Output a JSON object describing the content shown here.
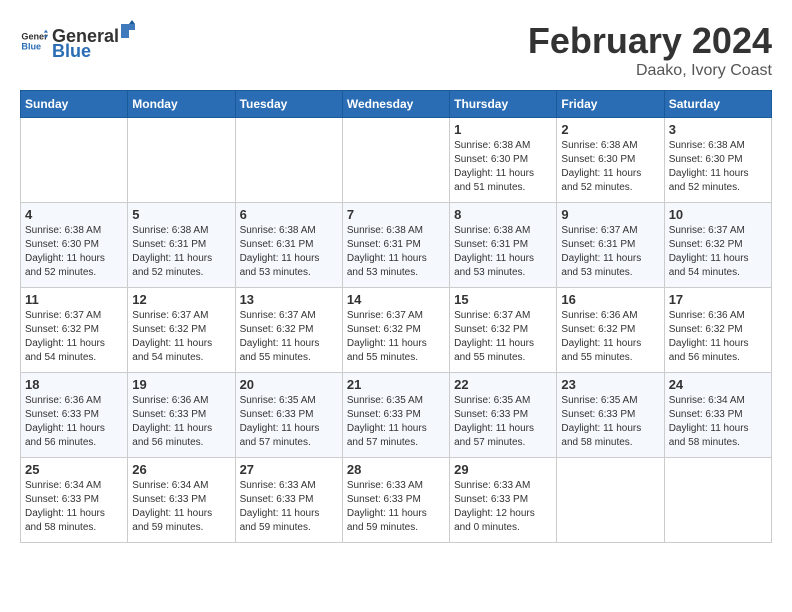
{
  "logo": {
    "text_general": "General",
    "text_blue": "Blue"
  },
  "header": {
    "title": "February 2024",
    "subtitle": "Daako, Ivory Coast"
  },
  "days_of_week": [
    "Sunday",
    "Monday",
    "Tuesday",
    "Wednesday",
    "Thursday",
    "Friday",
    "Saturday"
  ],
  "weeks": [
    [
      {
        "day": "",
        "empty": true
      },
      {
        "day": "",
        "empty": true
      },
      {
        "day": "",
        "empty": true
      },
      {
        "day": "",
        "empty": true
      },
      {
        "day": "1",
        "sunrise": "6:38 AM",
        "sunset": "6:30 PM",
        "daylight": "11 hours and 51 minutes."
      },
      {
        "day": "2",
        "sunrise": "6:38 AM",
        "sunset": "6:30 PM",
        "daylight": "11 hours and 52 minutes."
      },
      {
        "day": "3",
        "sunrise": "6:38 AM",
        "sunset": "6:30 PM",
        "daylight": "11 hours and 52 minutes."
      }
    ],
    [
      {
        "day": "4",
        "sunrise": "6:38 AM",
        "sunset": "6:30 PM",
        "daylight": "11 hours and 52 minutes."
      },
      {
        "day": "5",
        "sunrise": "6:38 AM",
        "sunset": "6:31 PM",
        "daylight": "11 hours and 52 minutes."
      },
      {
        "day": "6",
        "sunrise": "6:38 AM",
        "sunset": "6:31 PM",
        "daylight": "11 hours and 53 minutes."
      },
      {
        "day": "7",
        "sunrise": "6:38 AM",
        "sunset": "6:31 PM",
        "daylight": "11 hours and 53 minutes."
      },
      {
        "day": "8",
        "sunrise": "6:38 AM",
        "sunset": "6:31 PM",
        "daylight": "11 hours and 53 minutes."
      },
      {
        "day": "9",
        "sunrise": "6:37 AM",
        "sunset": "6:31 PM",
        "daylight": "11 hours and 53 minutes."
      },
      {
        "day": "10",
        "sunrise": "6:37 AM",
        "sunset": "6:32 PM",
        "daylight": "11 hours and 54 minutes."
      }
    ],
    [
      {
        "day": "11",
        "sunrise": "6:37 AM",
        "sunset": "6:32 PM",
        "daylight": "11 hours and 54 minutes."
      },
      {
        "day": "12",
        "sunrise": "6:37 AM",
        "sunset": "6:32 PM",
        "daylight": "11 hours and 54 minutes."
      },
      {
        "day": "13",
        "sunrise": "6:37 AM",
        "sunset": "6:32 PM",
        "daylight": "11 hours and 55 minutes."
      },
      {
        "day": "14",
        "sunrise": "6:37 AM",
        "sunset": "6:32 PM",
        "daylight": "11 hours and 55 minutes."
      },
      {
        "day": "15",
        "sunrise": "6:37 AM",
        "sunset": "6:32 PM",
        "daylight": "11 hours and 55 minutes."
      },
      {
        "day": "16",
        "sunrise": "6:36 AM",
        "sunset": "6:32 PM",
        "daylight": "11 hours and 55 minutes."
      },
      {
        "day": "17",
        "sunrise": "6:36 AM",
        "sunset": "6:32 PM",
        "daylight": "11 hours and 56 minutes."
      }
    ],
    [
      {
        "day": "18",
        "sunrise": "6:36 AM",
        "sunset": "6:33 PM",
        "daylight": "11 hours and 56 minutes."
      },
      {
        "day": "19",
        "sunrise": "6:36 AM",
        "sunset": "6:33 PM",
        "daylight": "11 hours and 56 minutes."
      },
      {
        "day": "20",
        "sunrise": "6:35 AM",
        "sunset": "6:33 PM",
        "daylight": "11 hours and 57 minutes."
      },
      {
        "day": "21",
        "sunrise": "6:35 AM",
        "sunset": "6:33 PM",
        "daylight": "11 hours and 57 minutes."
      },
      {
        "day": "22",
        "sunrise": "6:35 AM",
        "sunset": "6:33 PM",
        "daylight": "11 hours and 57 minutes."
      },
      {
        "day": "23",
        "sunrise": "6:35 AM",
        "sunset": "6:33 PM",
        "daylight": "11 hours and 58 minutes."
      },
      {
        "day": "24",
        "sunrise": "6:34 AM",
        "sunset": "6:33 PM",
        "daylight": "11 hours and 58 minutes."
      }
    ],
    [
      {
        "day": "25",
        "sunrise": "6:34 AM",
        "sunset": "6:33 PM",
        "daylight": "11 hours and 58 minutes."
      },
      {
        "day": "26",
        "sunrise": "6:34 AM",
        "sunset": "6:33 PM",
        "daylight": "11 hours and 59 minutes."
      },
      {
        "day": "27",
        "sunrise": "6:33 AM",
        "sunset": "6:33 PM",
        "daylight": "11 hours and 59 minutes."
      },
      {
        "day": "28",
        "sunrise": "6:33 AM",
        "sunset": "6:33 PM",
        "daylight": "11 hours and 59 minutes."
      },
      {
        "day": "29",
        "sunrise": "6:33 AM",
        "sunset": "6:33 PM",
        "daylight": "12 hours and 0 minutes."
      },
      {
        "day": "",
        "empty": true
      },
      {
        "day": "",
        "empty": true
      }
    ]
  ]
}
